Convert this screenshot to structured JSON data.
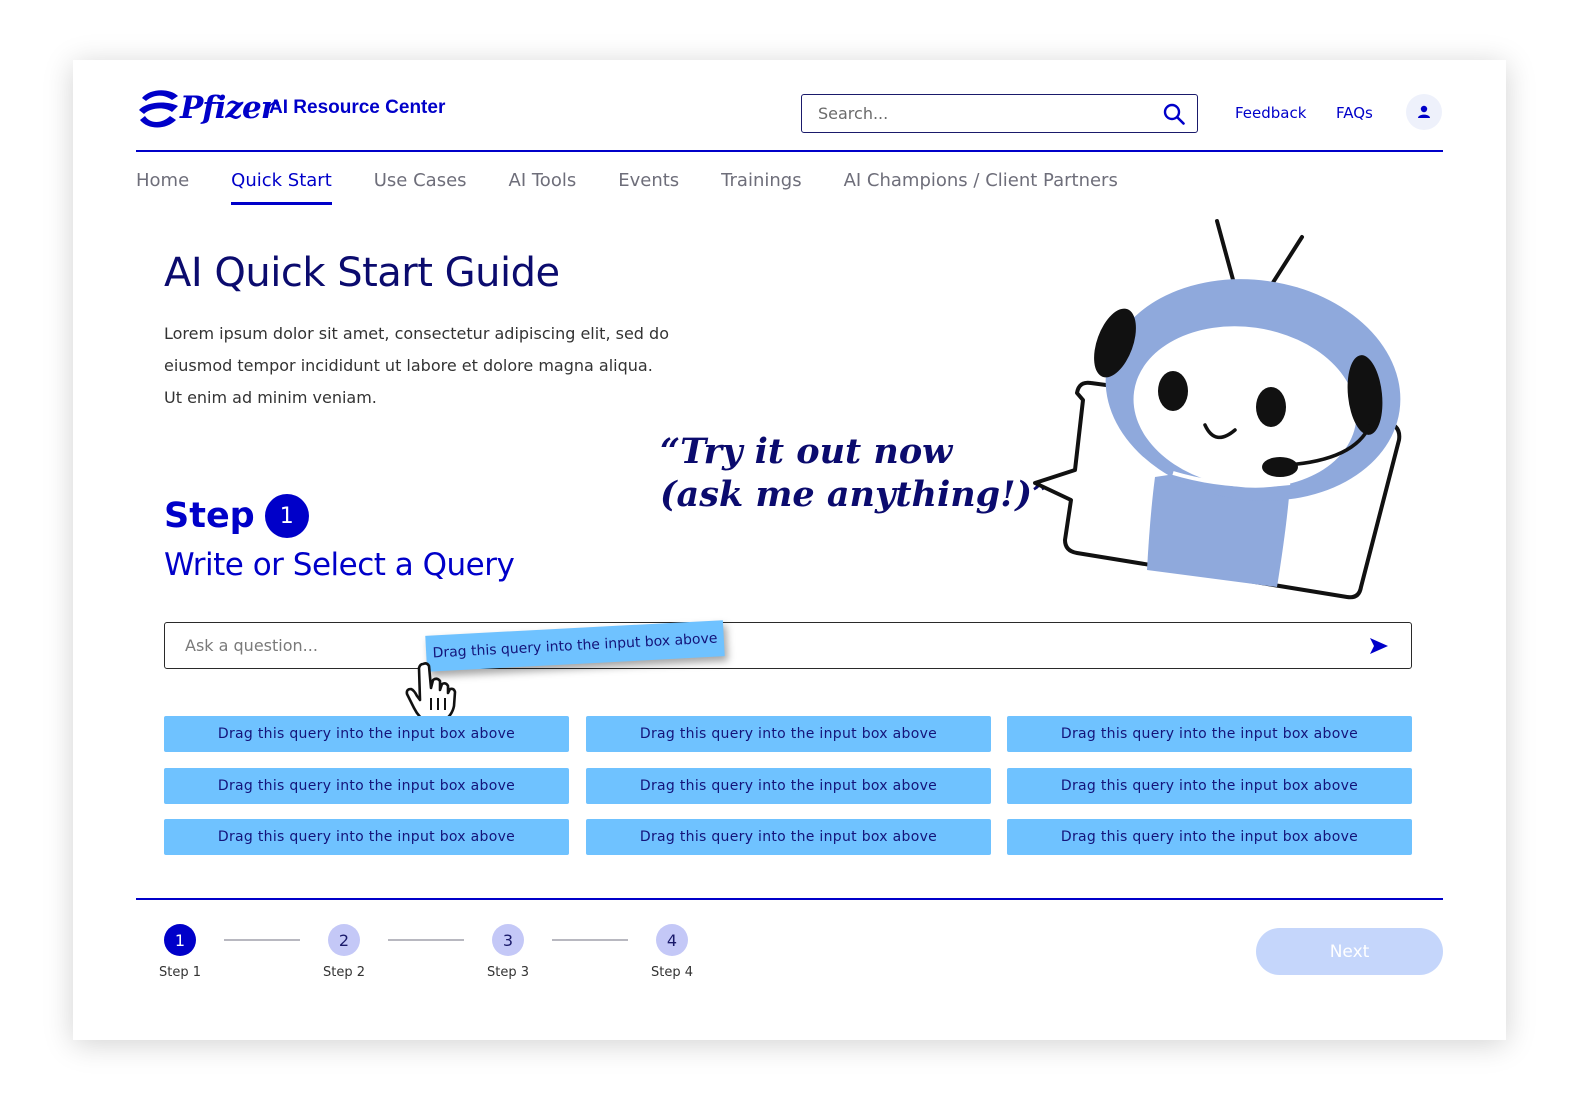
{
  "header": {
    "logo_text": "Pfizer",
    "site_title": "AI Resource Center",
    "search_placeholder": "Search...",
    "links": [
      "Feedback",
      "FAQs"
    ]
  },
  "nav": {
    "items": [
      "Home",
      "Quick Start",
      "Use Cases",
      "AI Tools",
      "Events",
      "Trainings",
      "AI Champions / Client Partners"
    ],
    "active": "Quick Start"
  },
  "hero": {
    "title": "AI Quick Start Guide",
    "intro_lines": [
      "Lorem ipsum dolor sit amet, consectetur adipiscing elit, sed do",
      "eiusmod tempor incididunt ut labore et dolore magna aliqua.",
      "Ut enim ad minim veniam."
    ],
    "speech_lines": [
      "“Try it out now",
      "(ask me anything!)”"
    ]
  },
  "step": {
    "word": "Step",
    "number": "1",
    "subtitle": "Write or Select a Query"
  },
  "query": {
    "placeholder": "Ask a question...",
    "dragging_chip": "Drag this query into the input box above",
    "chips": [
      "Drag this query into the input box above",
      "Drag this query into the input box above",
      "Drag this query into the input box above",
      "Drag this query into the input box above",
      "Drag this query into the input box above",
      "Drag this query into the input box above",
      "Drag this query into the input box above",
      "Drag this query into the input box above",
      "Drag this query into the input box above"
    ]
  },
  "stepper": {
    "steps": [
      {
        "num": "1",
        "label": "Step 1"
      },
      {
        "num": "2",
        "label": "Step 2"
      },
      {
        "num": "3",
        "label": "Step 3"
      },
      {
        "num": "4",
        "label": "Step 4"
      }
    ],
    "current": 1,
    "next_label": "Next"
  },
  "colors": {
    "brand": "#0000c9",
    "chip": "#6fc2ff",
    "robot": "#8fa9dc",
    "next_disabled": "#c5d6fb"
  },
  "icons": [
    "pfizer-logo-icon",
    "search-icon",
    "user-icon",
    "send-icon",
    "hand-cursor-icon",
    "robot-illustration"
  ]
}
